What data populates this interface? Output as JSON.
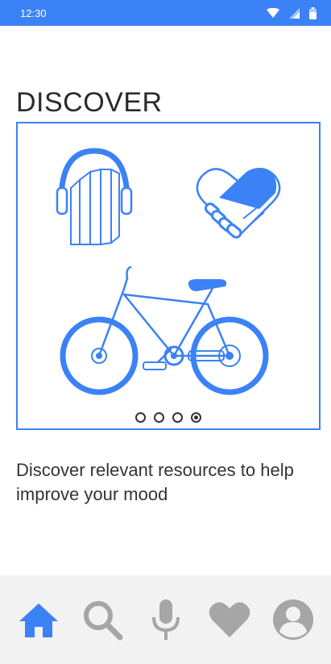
{
  "status_bar": {
    "time": "12:30",
    "icons": [
      "wifi-icon",
      "signal-icon",
      "battery-icon"
    ]
  },
  "page": {
    "title": "DISCOVER",
    "description": "Discover relevant resources to help improve your mood"
  },
  "carousel": {
    "illustrations": [
      "headphones-books-icon",
      "handshake-heart-icon",
      "bicycle-icon"
    ],
    "page_count": 4,
    "active_index": 3
  },
  "bottom_nav": {
    "items": [
      {
        "icon": "home-icon",
        "active": true
      },
      {
        "icon": "search-icon",
        "active": false
      },
      {
        "icon": "microphone-icon",
        "active": false
      },
      {
        "icon": "heart-icon",
        "active": false
      },
      {
        "icon": "profile-icon",
        "active": false
      }
    ]
  },
  "colors": {
    "accent": "#3b82f6",
    "inactive": "#a6a6a6",
    "nav_background": "#f2f2f2",
    "text": "#333333"
  }
}
